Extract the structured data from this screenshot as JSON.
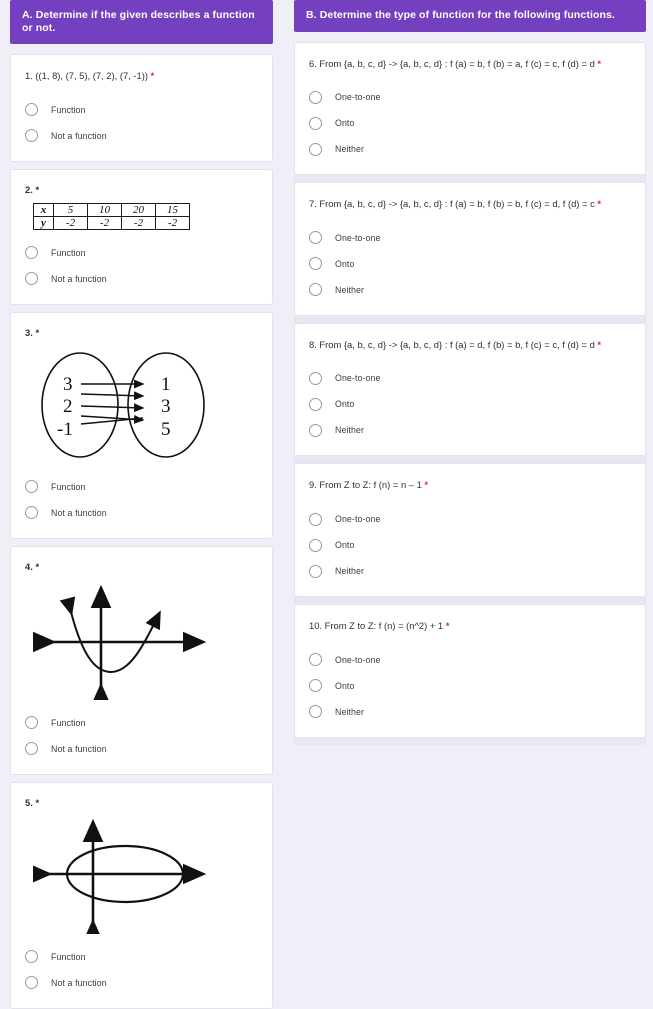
{
  "form": {
    "background_color": "#f0eef7",
    "header_color": "#7540c0",
    "required_marker": "*"
  },
  "sections": [
    {
      "id": "section-a",
      "title": "A. Determine if the given describes a function or not.",
      "options": [
        "Function",
        "Not a function"
      ],
      "questions": [
        {
          "number": "1.",
          "text": "1. ((1, 8), (7, 5), (7, 2), (7, -1))",
          "required": "*",
          "figure": "none"
        },
        {
          "number": "2.",
          "text": "2.",
          "required": "*",
          "figure": "table",
          "table": {
            "row_labels": [
              "x",
              "y"
            ],
            "rows": [
              [
                "5",
                "10",
                "20",
                "15"
              ],
              [
                "-2",
                "-2",
                "-2",
                "-2"
              ]
            ]
          }
        },
        {
          "number": "3.",
          "text": "3.",
          "required": "*",
          "figure": "mapping-diagram",
          "mapping": {
            "domain": [
              "3",
              "2",
              "-1"
            ],
            "codomain": [
              "1",
              "3",
              "5"
            ]
          }
        },
        {
          "number": "4.",
          "text": "4.",
          "required": "*",
          "figure": "parabola-graph"
        },
        {
          "number": "5.",
          "text": "5.",
          "required": "*",
          "figure": "ellipse-graph"
        }
      ]
    },
    {
      "id": "section-b",
      "title": "B. Determine the type of function for the following functions.",
      "options": [
        "One-to-one",
        "Onto",
        "Neither"
      ],
      "questions": [
        {
          "number": "6.",
          "text": "6. From {a, b, c, d}  ->  {a, b, c, d} : f (a) = b, f (b) = a, f (c) = c, f (d) = d",
          "required": "*"
        },
        {
          "number": "7.",
          "text": "7. From {a, b, c, d}  ->  {a, b, c, d} :  f (a) = b, f (b) = b, f (c) = d, f (d) = c",
          "required": "*"
        },
        {
          "number": "8.",
          "text": "8. From {a, b, c, d}  ->  {a, b, c, d} :  f (a) = d, f (b) = b, f (c) = c, f (d) = d",
          "required": "*"
        },
        {
          "number": "9.",
          "text": "9. From Z to Z:  f (n) = n – 1",
          "required": "*"
        },
        {
          "number": "10.",
          "text": "10. From Z to Z:  f (n) = (n^2) + 1",
          "required": "*"
        }
      ]
    }
  ]
}
